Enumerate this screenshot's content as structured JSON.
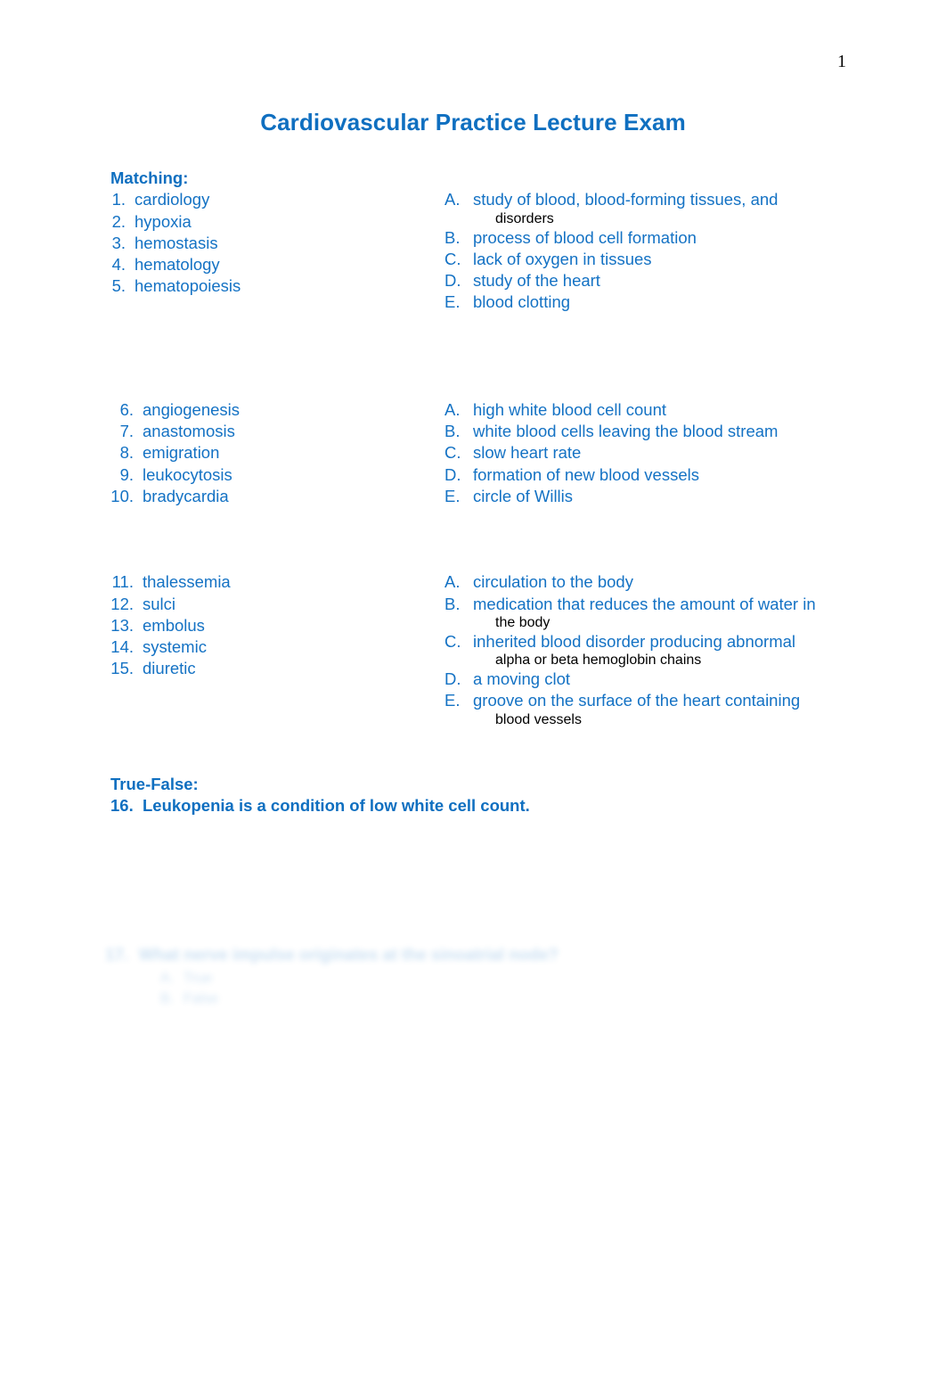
{
  "page": {
    "number": "1",
    "title": "Cardiovascular Practice Lecture Exam",
    "title_color": "#0f6fc0",
    "body_color": "#1472c4",
    "background": "#ffffff"
  },
  "sections": [
    {
      "heading": "Matching:",
      "blocks": [
        {
          "terms": [
            {
              "num": "1.",
              "text": "cardiology"
            },
            {
              "num": "2.",
              "text": "hypoxia"
            },
            {
              "num": "3.",
              "text": "hemostasis"
            },
            {
              "num": "4.",
              "text": "hematology"
            },
            {
              "num": "5.",
              "text": "hematopoiesis"
            }
          ],
          "definitions": [
            {
              "letter": "A.",
              "text": "study of blood, blood-forming tissues, and",
              "cont": "disorders"
            },
            {
              "letter": "B.",
              "text": "process of blood cell formation",
              "cont": ""
            },
            {
              "letter": "C.",
              "text": "lack of oxygen in tissues",
              "cont": ""
            },
            {
              "letter": "D.",
              "text": "study of the heart",
              "cont": ""
            },
            {
              "letter": "E.",
              "text": "blood clotting",
              "cont": ""
            }
          ]
        },
        {
          "terms": [
            {
              "num": "6.",
              "text": "angiogenesis"
            },
            {
              "num": "7.",
              "text": "anastomosis"
            },
            {
              "num": "8.",
              "text": "emigration"
            },
            {
              "num": "9.",
              "text": "leukocytosis"
            },
            {
              "num": "10.",
              "text": "bradycardia"
            }
          ],
          "definitions": [
            {
              "letter": "A.",
              "text": "high white blood cell count",
              "cont": ""
            },
            {
              "letter": "B.",
              "text": "white blood cells leaving the blood stream",
              "cont": ""
            },
            {
              "letter": "C.",
              "text": "slow heart rate",
              "cont": ""
            },
            {
              "letter": "D.",
              "text": "formation of new blood vessels",
              "cont": ""
            },
            {
              "letter": "E.",
              "text": "circle of Willis",
              "cont": ""
            }
          ]
        },
        {
          "terms": [
            {
              "num": "11.",
              "text": "thalessemia"
            },
            {
              "num": "12.",
              "text": "sulci"
            },
            {
              "num": "13.",
              "text": "embolus"
            },
            {
              "num": "14.",
              "text": "systemic"
            },
            {
              "num": "15.",
              "text": "diuretic"
            }
          ],
          "definitions": [
            {
              "letter": "A.",
              "text": "circulation to the body",
              "cont": ""
            },
            {
              "letter": "B.",
              "text": "medication that reduces the amount of water in",
              "cont": "the body"
            },
            {
              "letter": "C.",
              "text": "inherited blood disorder producing abnormal",
              "cont": "alpha or beta hemoglobin chains"
            },
            {
              "letter": "D.",
              "text": "a moving clot",
              "cont": ""
            },
            {
              "letter": "E.",
              "text": "groove on the surface of the heart containing",
              "cont": "blood vessels"
            }
          ]
        }
      ]
    }
  ],
  "true_false": {
    "heading": "True-False:",
    "items": [
      {
        "num": "16.",
        "text": "Leukopenia is a condition of low white cell count."
      }
    ]
  },
  "faded": {
    "note": "illegible faded text",
    "small": "",
    "question_num": "",
    "question_text": "",
    "options": [
      {
        "letter": "",
        "text": ""
      },
      {
        "letter": "",
        "text": ""
      }
    ]
  }
}
